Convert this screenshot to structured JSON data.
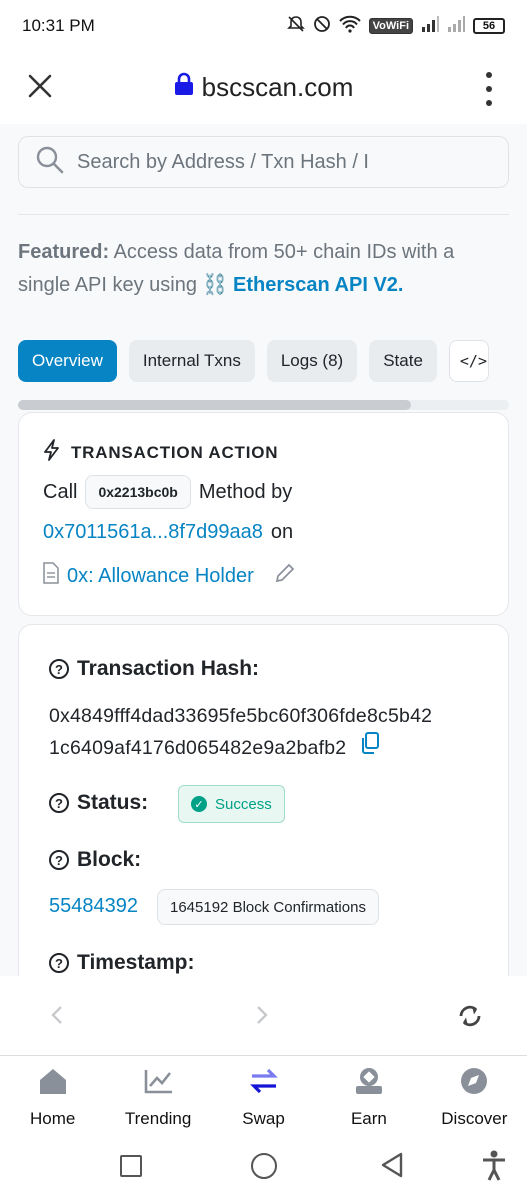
{
  "status_bar": {
    "time": "10:31 PM",
    "network_label": "VoWiFi",
    "battery": "56"
  },
  "browser": {
    "url": "bscscan.com"
  },
  "search": {
    "placeholder": "Search by Address / Txn Hash / I"
  },
  "featured": {
    "label": "Featured:",
    "text": "Access data from 50+ chain IDs with a single API key using",
    "link_emoji": "⛓️",
    "link_text": "Etherscan API V2."
  },
  "tabs": [
    {
      "label": "Overview",
      "active": true
    },
    {
      "label": "Internal Txns"
    },
    {
      "label": "Logs (8)"
    },
    {
      "label": "State"
    },
    {
      "label": "</>"
    }
  ],
  "tabs_scroll_fraction": 0.8,
  "transaction_action": {
    "title": "TRANSACTION ACTION",
    "call_label": "Call",
    "method_id": "0x2213bc0b",
    "method_by": "Method by",
    "from_address": "0x7011561a...8f7d99aa8",
    "on_label": "on",
    "contract": "0x: Allowance Holder"
  },
  "details": {
    "hash_label": "Transaction Hash:",
    "hash_line1": "0x4849fff4dad33695fe5bc60f306fde8c5b42",
    "hash_line2": "1c6409af4176d065482e9a2bafb2",
    "status_label": "Status:",
    "status_value": "Success",
    "block_label": "Block:",
    "block_number": "55484392",
    "confirmations": "1645192 Block Confirmations",
    "timestamp_label": "Timestamp:"
  },
  "bottom_tabs": [
    {
      "label": "Home",
      "icon": "home-icon"
    },
    {
      "label": "Trending",
      "icon": "trending-icon"
    },
    {
      "label": "Swap",
      "icon": "swap-icon"
    },
    {
      "label": "Earn",
      "icon": "earn-icon"
    },
    {
      "label": "Discover",
      "icon": "discover-icon"
    }
  ],
  "colors": {
    "accent": "#0784c3",
    "success": "#00a186"
  }
}
